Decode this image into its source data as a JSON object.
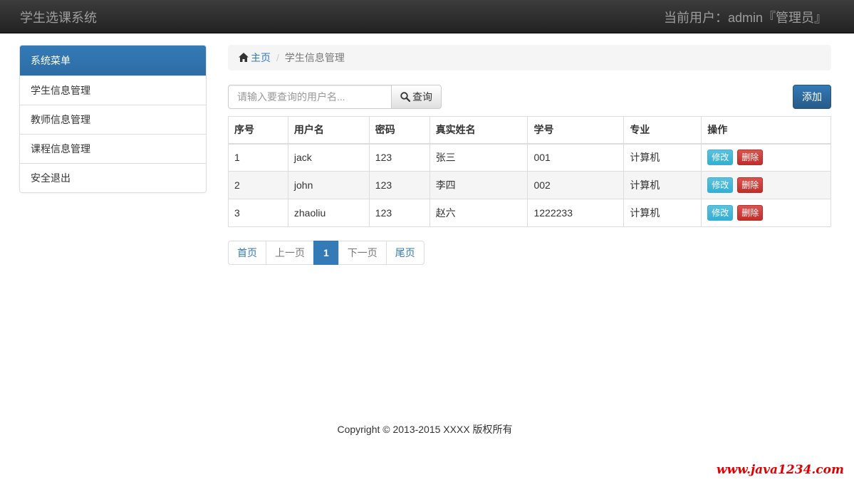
{
  "navbar": {
    "brand": "学生选课系统",
    "current_user": "当前用户：admin『管理员』"
  },
  "sidebar": {
    "heading": "系统菜单",
    "items": [
      {
        "label": "学生信息管理"
      },
      {
        "label": "教师信息管理"
      },
      {
        "label": "课程信息管理"
      },
      {
        "label": "安全退出"
      }
    ]
  },
  "breadcrumb": {
    "home": "主页",
    "separator": "/",
    "current": "学生信息管理"
  },
  "toolbar": {
    "search_placeholder": "请输入要查询的用户名...",
    "search_label": "查询",
    "add_label": "添加"
  },
  "table": {
    "headers": [
      "序号",
      "用户名",
      "密码",
      "真实姓名",
      "学号",
      "专业",
      "操作"
    ],
    "rows": [
      {
        "index": "1",
        "username": "jack",
        "password": "123",
        "real_name": "张三",
        "student_no": "001",
        "major": "计算机"
      },
      {
        "index": "2",
        "username": "john",
        "password": "123",
        "real_name": "李四",
        "student_no": "002",
        "major": "计算机"
      },
      {
        "index": "3",
        "username": "zhaoliu",
        "password": "123",
        "real_name": "赵六",
        "student_no": "1222233",
        "major": "计算机"
      }
    ],
    "edit_label": "修改",
    "delete_label": "删除"
  },
  "pagination": {
    "first": "首页",
    "prev": "上一页",
    "current": "1",
    "next": "下一页",
    "last": "尾页"
  },
  "footer": {
    "text": "Copyright © 2013-2015 XXXX 版权所有"
  },
  "watermark": {
    "text": "www.java1234.com"
  },
  "colors": {
    "primary": "#337ab7",
    "info": "#5bc0de",
    "danger": "#d9534f",
    "navbar": "#222222",
    "watermark": "#e00000"
  }
}
